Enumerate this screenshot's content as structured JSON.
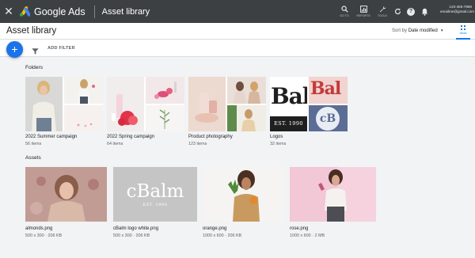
{
  "topbar": {
    "close_icon": "close-icon",
    "brand": "Google Ads",
    "page": "Asset library",
    "tools": [
      {
        "label": "GO TO",
        "icon": "search-icon"
      },
      {
        "label": "REPORTS",
        "icon": "reports-icon"
      },
      {
        "label": "TOOLS",
        "icon": "wrench-icon"
      }
    ],
    "account": {
      "line1": "123-456-7890",
      "line2": "emailme@gmail.com"
    }
  },
  "header": {
    "title": "Asset library",
    "sort_label": "Sort by",
    "sort_value": "Date modified",
    "views_label": "views"
  },
  "filterbar": {
    "add_icon": "+",
    "filter_label": "ADD FILTER"
  },
  "folders": {
    "heading": "Folders",
    "items": [
      {
        "name": "2022 Summer campaign",
        "meta": "56 items"
      },
      {
        "name": "2022 Spring campaign",
        "meta": "64 items"
      },
      {
        "name": "Product photography",
        "meta": "123 items"
      },
      {
        "name": "Logos",
        "meta": "32 items"
      }
    ]
  },
  "assets": {
    "heading": "Assets",
    "items": [
      {
        "name": "almonds.png",
        "meta": "500 x 300 · 206 KB"
      },
      {
        "name": "cBalm logo white.png",
        "meta": "500 x 300 · 206 KB"
      },
      {
        "name": "orange.png",
        "meta": "1000 x 600 · 206 KB"
      },
      {
        "name": "rose.png",
        "meta": "1000 x 600 · 2 MB"
      }
    ]
  },
  "logos_thumb": {
    "word1": "Bal",
    "word2": "Bal",
    "est": "EST. 1990",
    "mono": "cB"
  },
  "cbalm_thumb": {
    "word": "cBalm",
    "est": "EST. 1990"
  },
  "colors": {
    "accent": "#1a73e8",
    "topbar": "#3c4043",
    "background": "#f1f3f4"
  }
}
